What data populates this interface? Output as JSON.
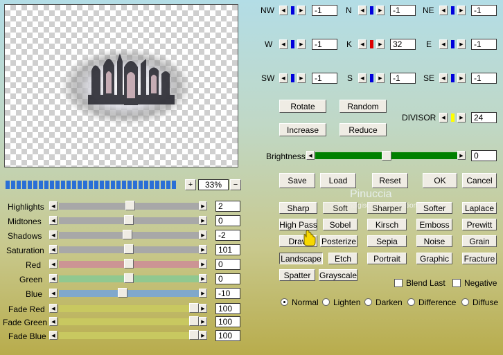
{
  "kernel": {
    "rows": [
      [
        {
          "label": "NW",
          "value": "-1",
          "color": "#0000dd"
        },
        {
          "label": "N",
          "value": "-1",
          "color": "#0000dd"
        },
        {
          "label": "NE",
          "value": "-1",
          "color": "#0000dd"
        }
      ],
      [
        {
          "label": "W",
          "value": "-1",
          "color": "#0000dd"
        },
        {
          "label": "K",
          "value": "32",
          "color": "#dd0000"
        },
        {
          "label": "E",
          "value": "-1",
          "color": "#0000dd"
        }
      ],
      [
        {
          "label": "SW",
          "value": "-1",
          "color": "#0000dd"
        },
        {
          "label": "S",
          "value": "-1",
          "color": "#0000dd"
        },
        {
          "label": "SE",
          "value": "-1",
          "color": "#0000dd"
        }
      ]
    ]
  },
  "buttons": {
    "rotate": "Rotate",
    "random": "Random",
    "increase": "Increase",
    "reduce": "Reduce",
    "save": "Save",
    "load": "Load",
    "reset": "Reset",
    "ok": "OK",
    "cancel": "Cancel"
  },
  "divisor": {
    "label": "DIVISOR",
    "value": "24",
    "color": "#ffff00"
  },
  "brightness": {
    "label": "Brightness",
    "value": "0",
    "level_fraction": 0.5,
    "color": "#008000"
  },
  "zoom": {
    "plus": "+",
    "value": "33%",
    "minus": "−"
  },
  "adjustments": [
    {
      "label": "Highlights",
      "value": "2",
      "fraction": 0.51,
      "color": "#a8a8a8"
    },
    {
      "label": "Midtones",
      "value": "0",
      "fraction": 0.5,
      "color": "#a8a8a8"
    },
    {
      "label": "Shadows",
      "value": "-2",
      "fraction": 0.49,
      "color": "#a8a8a8"
    },
    {
      "label": "Saturation",
      "value": "101",
      "fraction": 0.5,
      "color": "#a8a8a8"
    },
    {
      "label": "Red",
      "value": "0",
      "fraction": 0.5,
      "color": "#cc9494"
    },
    {
      "label": "Green",
      "value": "0",
      "fraction": 0.5,
      "color": "#90c890"
    },
    {
      "label": "Blue",
      "value": "-10",
      "fraction": 0.45,
      "color": "#80a8cc"
    },
    {
      "label": "Fade Red",
      "value": "100",
      "fraction": 1.0,
      "color": "#c8c860"
    },
    {
      "label": "Fade Green",
      "value": "100",
      "fraction": 1.0,
      "color": "#c8c860"
    },
    {
      "label": "Fade Blue",
      "value": "100",
      "fraction": 1.0,
      "color": "#c8c860"
    }
  ],
  "presets": [
    [
      "Sharp",
      "Soft",
      "Sharper",
      "Softer",
      "Laplace"
    ],
    [
      "High Pass",
      "Sobel",
      "Kirsch",
      "Emboss",
      "Prewitt"
    ],
    [
      "Draw",
      "Posterize",
      "Sepia",
      "Noise",
      "Grain"
    ],
    [
      "Landscape",
      "Etch",
      "Portrait",
      "Graphic",
      "Fracture"
    ],
    [
      "Spatter",
      "Grayscale"
    ]
  ],
  "selected_preset": "Landscape",
  "options": {
    "blend_last": {
      "label": "Blend Last",
      "checked": false
    },
    "negative": {
      "label": "Negative",
      "checked": false
    }
  },
  "modes": {
    "items": [
      "Normal",
      "Lighten",
      "Darken",
      "Difference",
      "Diffuse"
    ],
    "selected": "Normal"
  },
  "watermark": {
    "title": "Pinuccia",
    "url": "www.mdigiscrapwebcreations.eu"
  },
  "colors": {
    "zoom_segments": "#2a6fd6",
    "selected_preset_border": "#555555"
  }
}
